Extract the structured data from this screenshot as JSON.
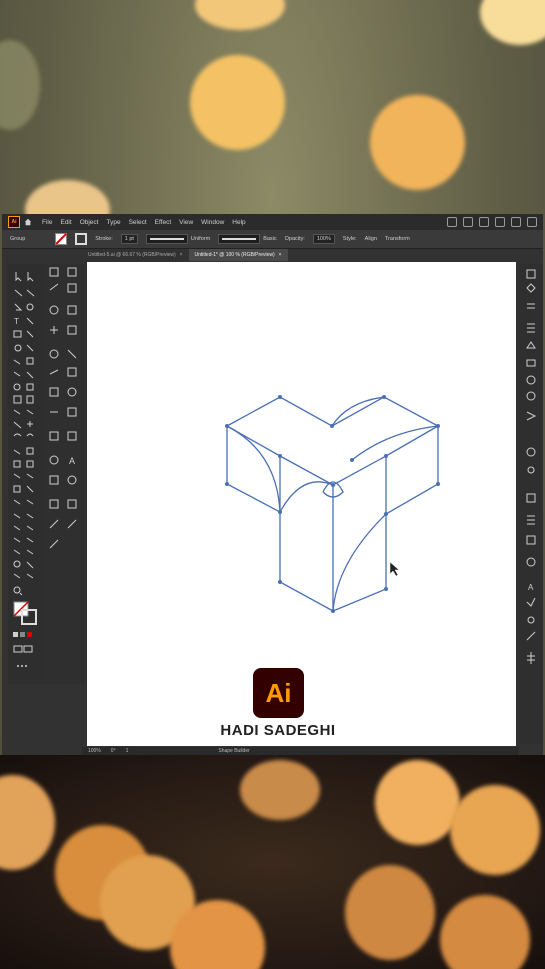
{
  "app": {
    "logo_label": "Ai",
    "menu": [
      "File",
      "Edit",
      "Object",
      "Type",
      "Select",
      "Effect",
      "View",
      "Window",
      "Help"
    ]
  },
  "control_bar": {
    "group_label": "Group",
    "stroke_label": "Stroke:",
    "stroke_value": "1 pt",
    "profile_uniform": "Uniform",
    "brush_basic": "Basic",
    "opacity_label": "Opacity:",
    "opacity_value": "100%",
    "style_label": "Style:",
    "align_label": "Align",
    "transform_label": "Transform"
  },
  "tabs": [
    {
      "label": "Untitled-5.ai @ 66.67 % (RGB/Preview)"
    },
    {
      "label": "Untitled-1* @ 100 % (RGB/Preview)"
    }
  ],
  "status": {
    "zoom": "100%",
    "rotation": "0°",
    "page": "1",
    "tool_name": "Shape Builder"
  },
  "watermark": {
    "logo_text": "Ai",
    "author": "HADI SADEGHI"
  },
  "colors": {
    "path_blue": "#4a6fb5",
    "ai_orange": "#ff9a00",
    "ai_dark": "#330000"
  }
}
